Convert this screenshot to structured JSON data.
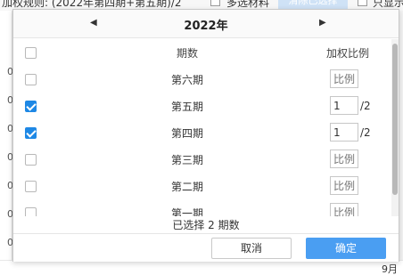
{
  "background": {
    "rule_text": "加权规则: (2022年第四期+第五期)/2",
    "multi_select_label": "多选材料",
    "clear_button_label": "清除已选择",
    "other_label": "只显示",
    "left_ticks": [
      "0",
      "0",
      "0",
      "0",
      "0",
      "0",
      "0"
    ],
    "month_label": "9月"
  },
  "popup": {
    "year": "2022年",
    "prev_icon": "◀",
    "next_icon": "▶",
    "header": {
      "period_label": "期数",
      "weight_label": "加权比例"
    },
    "rows": [
      {
        "name": "第六期",
        "checked": false,
        "weight": "",
        "placeholder": "比例",
        "slash": ""
      },
      {
        "name": "第五期",
        "checked": true,
        "weight": "1",
        "placeholder": "比例",
        "slash": "/2"
      },
      {
        "name": "第四期",
        "checked": true,
        "weight": "1",
        "placeholder": "比例",
        "slash": "/2"
      },
      {
        "name": "第三期",
        "checked": false,
        "weight": "",
        "placeholder": "比例",
        "slash": ""
      },
      {
        "name": "第二期",
        "checked": false,
        "weight": "",
        "placeholder": "比例",
        "slash": ""
      },
      {
        "name": "第一期",
        "checked": false,
        "weight": "",
        "placeholder": "比例",
        "slash": ""
      }
    ],
    "summary": "已选择 2 期数",
    "cancel_label": "取消",
    "ok_label": "确定"
  },
  "colors": {
    "accent": "#4a9ef2",
    "checkbox_checked": "#1e88e5"
  }
}
